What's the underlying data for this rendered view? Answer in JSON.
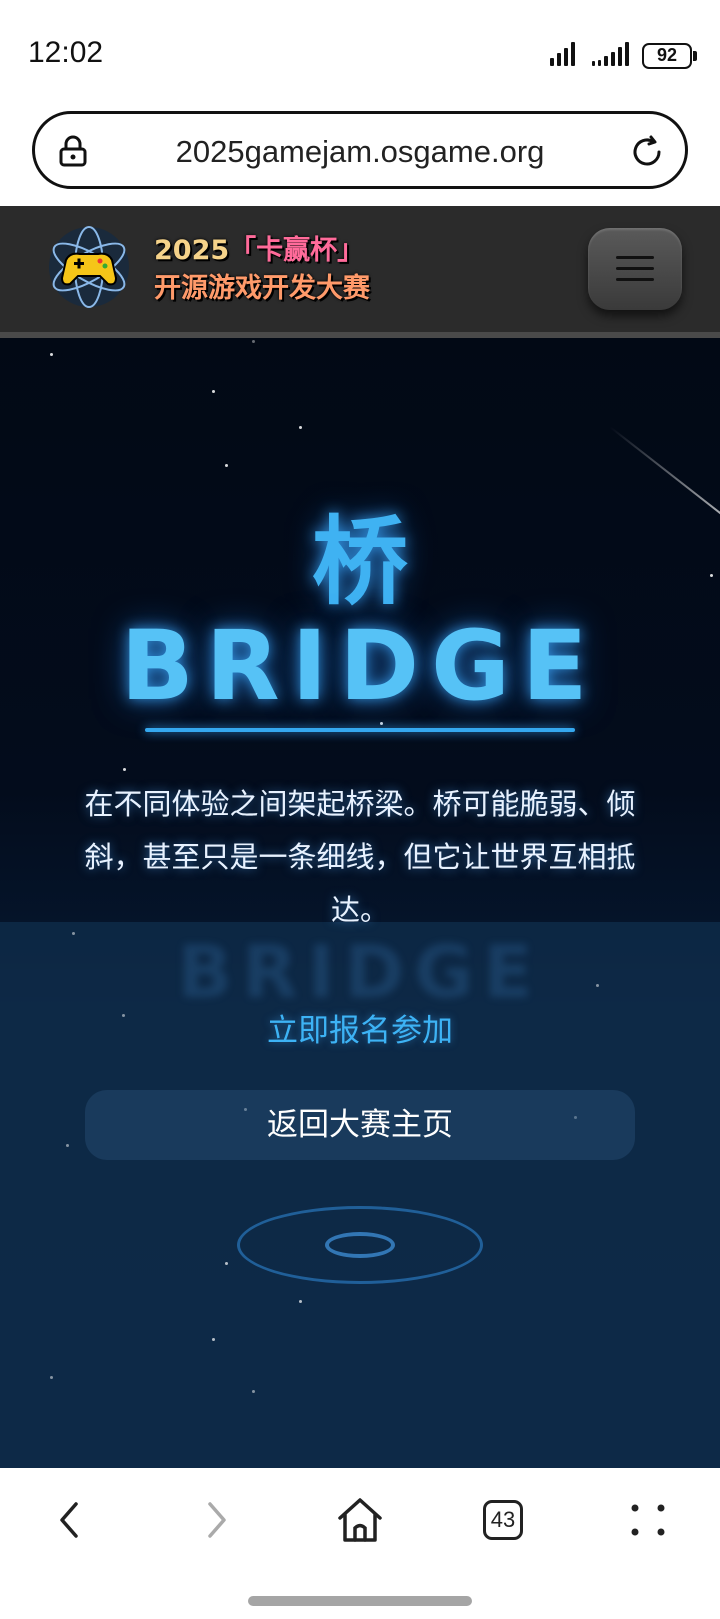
{
  "status_bar": {
    "time": "12:02",
    "battery": "92",
    "icons": [
      "signal-icon",
      "signal-icon",
      "battery-icon"
    ]
  },
  "browser": {
    "url": "2025gamejam.osgame.org",
    "icons": [
      "lock-icon",
      "reload-icon"
    ]
  },
  "site_header": {
    "logo_year": "2025",
    "logo_cup": "「卡赢杯」",
    "logo_subtitle": "开源游戏开发大赛",
    "menu_icon": "hamburger-menu-icon"
  },
  "hero": {
    "title_cn": "桥",
    "title_en": "BRIDGE",
    "tagline": "在不同体验之间架起桥梁。桥可能脆弱、倾斜，甚至只是一条细线，但它让世界互相抵达。",
    "register_link": "立即报名参加",
    "home_button": "返回大赛主页",
    "accent_color": "#3db3f5"
  },
  "bottom_nav": {
    "tabs_count": "43",
    "icons": [
      "back-icon",
      "forward-icon",
      "home-icon",
      "tabs-icon",
      "more-icon"
    ]
  }
}
